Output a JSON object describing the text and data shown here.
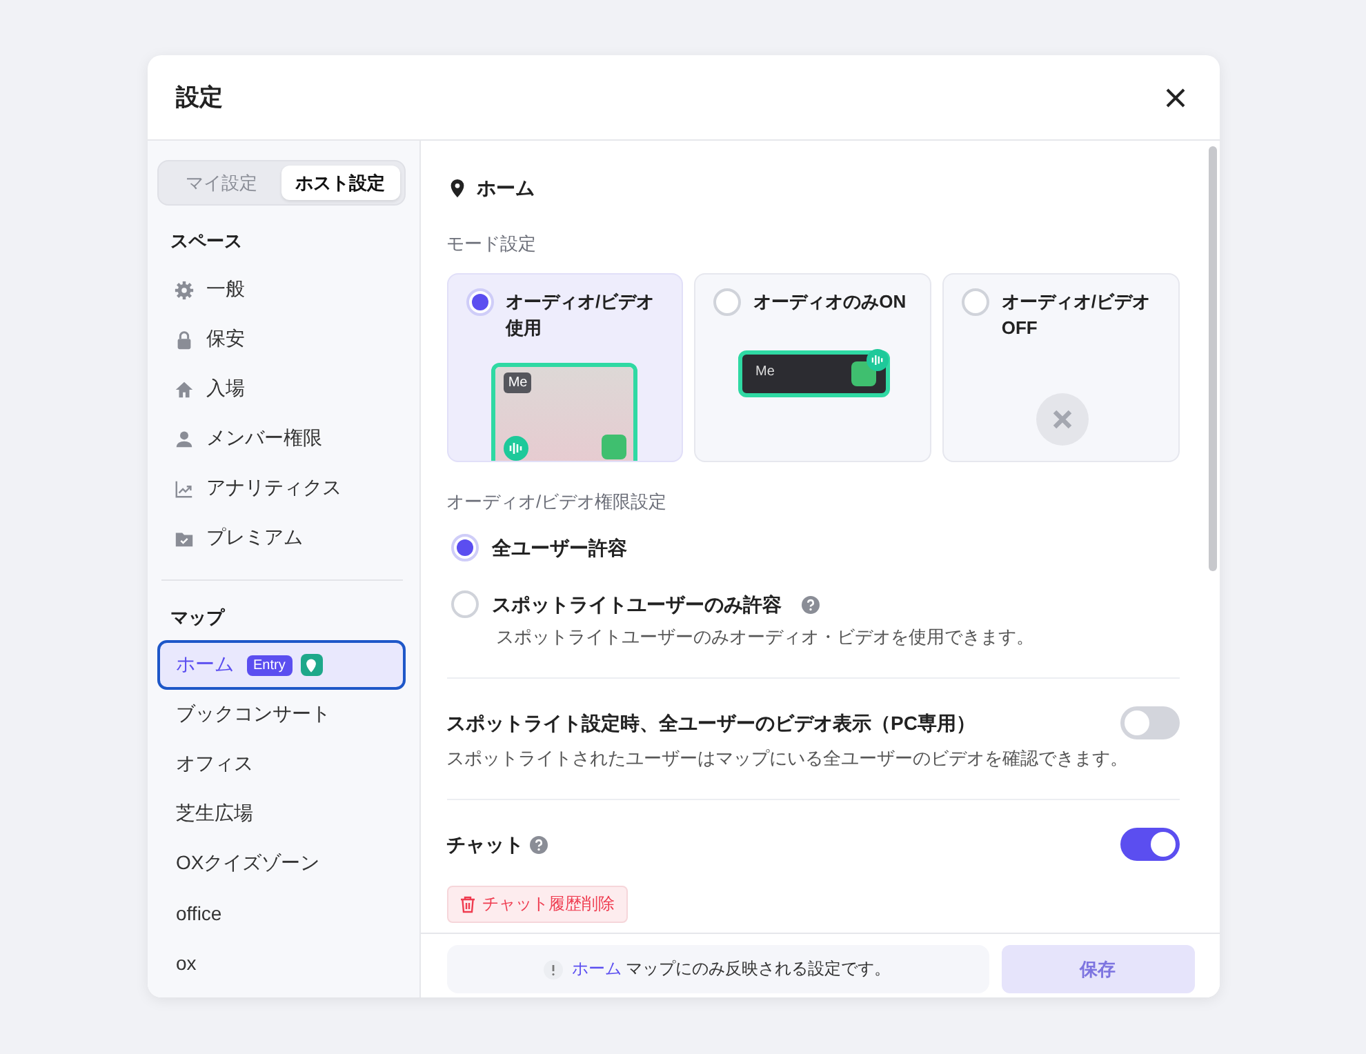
{
  "dialog": {
    "title": "設定"
  },
  "sidebar": {
    "tabs": [
      {
        "label": "マイ設定",
        "selected": false
      },
      {
        "label": "ホスト設定",
        "selected": true
      }
    ],
    "space_heading": "スペース",
    "space_items": [
      {
        "label": "一般"
      },
      {
        "label": "保安"
      },
      {
        "label": "入場"
      },
      {
        "label": "メンバー権限"
      },
      {
        "label": "アナリティクス"
      },
      {
        "label": "プレミアム"
      }
    ],
    "map_heading": "マップ",
    "map_items": [
      {
        "label": "ホーム",
        "selected": true,
        "badge": "Entry",
        "entry_pin": true
      },
      {
        "label": "ブックコンサート",
        "selected": false
      },
      {
        "label": "オフィス",
        "selected": false
      },
      {
        "label": "芝生広場",
        "selected": false
      },
      {
        "label": "OXクイズゾーン",
        "selected": false
      },
      {
        "label": "office",
        "selected": false
      },
      {
        "label": "ox",
        "selected": false
      }
    ]
  },
  "content": {
    "location": "ホーム",
    "mode": {
      "label": "モード設定",
      "options": [
        {
          "label": "オーディオ/ビデオ使用",
          "selected": true,
          "kind": "video",
          "preview_label": "Me"
        },
        {
          "label": "オーディオのみON",
          "selected": false,
          "kind": "audio",
          "preview_label": "Me"
        },
        {
          "label": "オーディオ/ビデオOFF",
          "selected": false,
          "kind": "off"
        }
      ]
    },
    "permission": {
      "label": "オーディオ/ビデオ権限設定",
      "options": [
        {
          "label": "全ユーザー許容",
          "selected": true
        },
        {
          "label": "スポットライトユーザーのみ許容",
          "selected": false,
          "help": true,
          "description": "スポットライトユーザーのみオーディオ・ビデオを使用できます。"
        }
      ]
    },
    "settings": [
      {
        "title": "スポットライト設定時、全ユーザーのビデオ表示（PC専用）",
        "description": "スポットライトされたユーザーはマップにいる全ユーザーのビデオを確認できます。",
        "on": false
      },
      {
        "title": "チャット",
        "help": true,
        "on": true,
        "action": "チャット履歴削除"
      }
    ]
  },
  "footer": {
    "notice_map": "ホーム",
    "notice_text": "マップにのみ反映される設定です。",
    "save": {
      "label": "保存",
      "disabled": true
    }
  }
}
